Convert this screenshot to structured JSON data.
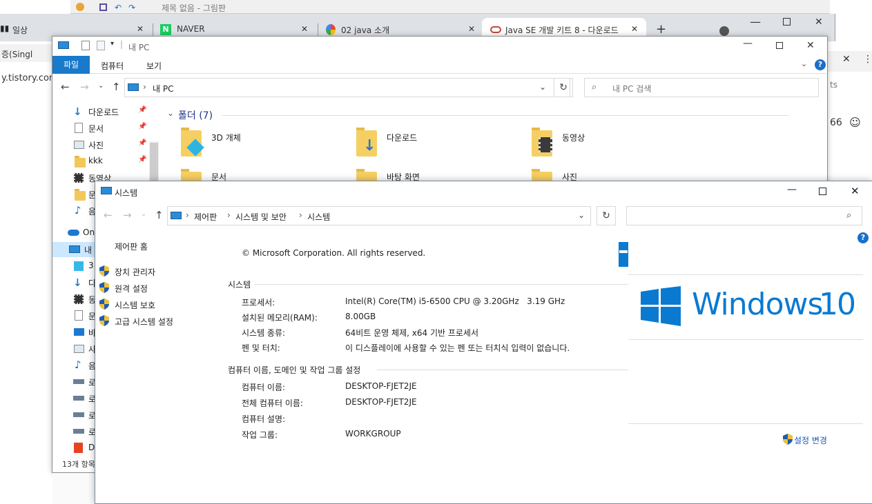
{
  "bg_window": {
    "title": "제목 없음 - 그림판",
    "left_text": "y.tistory.com",
    "left_tab_text": "증(Singl",
    "right_count": "66",
    "right_text": "ts"
  },
  "browser": {
    "tabs": [
      {
        "label": "일상"
      },
      {
        "label": "NAVER"
      },
      {
        "label": "02 java 소개"
      },
      {
        "label": "Java SE 개발 키트 8 - 다운로드"
      }
    ],
    "new_tab": "+"
  },
  "explorer": {
    "title": "내 PC",
    "ribbon_tabs": [
      "파일",
      "컴퓨터",
      "보기"
    ],
    "path": "내 PC",
    "search_placeholder": "내 PC 검색",
    "section_header": "폴더 (7)",
    "nav_items": [
      "다운로드",
      "문서",
      "사진",
      "kkk",
      "동영상",
      "문",
      "음",
      "On",
      "내",
      "3",
      "다",
      "동",
      "문",
      "바",
      "사",
      "음",
      "로",
      "로",
      "로",
      "로",
      "D"
    ],
    "folders": [
      "3D 개체",
      "다운로드",
      "동영상",
      "문서",
      "바탕 화면",
      "사진"
    ],
    "status": "13개 항목"
  },
  "system": {
    "title": "시스템",
    "breadcrumb": [
      "제어판",
      "시스템 및 보안",
      "시스템"
    ],
    "sidebar_home": "제어판 홈",
    "sidebar_links": [
      "장치 관리자",
      "원격 설정",
      "시스템 보호",
      "고급 시스템 설정"
    ],
    "copyright": "© Microsoft Corporation. All rights reserved.",
    "section_system": "시스템",
    "system_rows": [
      {
        "label": "프로세서:",
        "value": "Intel(R) Core(TM) i5-6500 CPU @ 3.20GHz   3.19 GHz"
      },
      {
        "label": "설치된 메모리(RAM):",
        "value": "8.00GB"
      },
      {
        "label": "시스템 종류:",
        "value": "64비트 운영 체제, x64 기반 프로세서"
      },
      {
        "label": "펜 및 터치:",
        "value": "이 디스플레이에 사용할 수 있는 펜 또는 터치식 입력이 없습니다."
      }
    ],
    "section_computer": "컴퓨터 이름, 도메인 및 작업 그룹 설정",
    "computer_rows": [
      {
        "label": "컴퓨터 이름:",
        "value": "DESKTOP-FJET2JE"
      },
      {
        "label": "전체 컴퓨터 이름:",
        "value": "DESKTOP-FJET2JE"
      },
      {
        "label": "컴퓨터 설명:",
        "value": ""
      },
      {
        "label": "작업 그룹:",
        "value": "WORKGROUP"
      }
    ],
    "logo_text": "Windows",
    "logo_version": "10",
    "change_settings": "설정 변경",
    "help": "?"
  },
  "colors": {
    "accent": "#0078d7",
    "win_blue": "#0a7ad1",
    "folder": "#f3c85a"
  }
}
